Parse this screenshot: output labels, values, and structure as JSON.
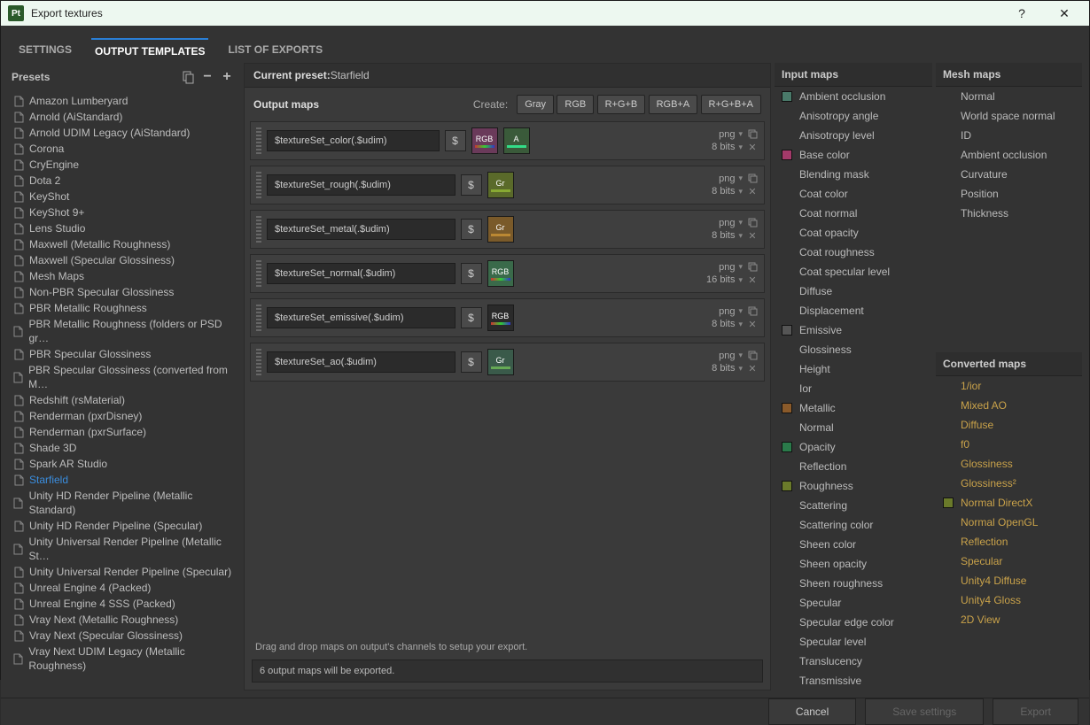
{
  "window": {
    "title": "Export textures",
    "app_badge": "Pt"
  },
  "tabs": {
    "settings": "SETTINGS",
    "output_templates": "OUTPUT TEMPLATES",
    "list_of_exports": "LIST OF EXPORTS"
  },
  "presets": {
    "header": "Presets",
    "items": [
      "Amazon Lumberyard",
      "Arnold (AiStandard)",
      "Arnold UDIM Legacy (AiStandard)",
      "Corona",
      "CryEngine",
      "Dota 2",
      "KeyShot",
      "KeyShot 9+",
      "Lens Studio",
      "Maxwell (Metallic Roughness)",
      "Maxwell (Specular Glossiness)",
      "Mesh Maps",
      "Non-PBR Specular Glossiness",
      "PBR Metallic Roughness",
      "PBR Metallic Roughness (folders or PSD gr…",
      "PBR Specular Glossiness",
      "PBR Specular Glossiness (converted from M…",
      "Redshift (rsMaterial)",
      "Renderman (pxrDisney)",
      "Renderman (pxrSurface)",
      "Shade 3D",
      "Spark AR Studio",
      "Starfield",
      "Unity HD Render Pipeline (Metallic Standard)",
      "Unity HD Render Pipeline (Specular)",
      "Unity Universal Render Pipeline (Metallic St…",
      "Unity Universal Render Pipeline (Specular)",
      "Unreal Engine 4 (Packed)",
      "Unreal Engine 4 SSS (Packed)",
      "Vray Next (Metallic Roughness)",
      "Vray Next (Specular Glossiness)",
      "Vray Next UDIM Legacy (Metallic Roughness)"
    ],
    "selected_index": 22
  },
  "current_preset": {
    "label": "Current preset:",
    "value": "Starfield"
  },
  "output": {
    "header": "Output maps",
    "create_label": "Create:",
    "buttons": [
      "Gray",
      "RGB",
      "R+G+B",
      "RGB+A",
      "R+G+B+A"
    ],
    "maps": [
      {
        "name": "$textureSet_color(.$udim)",
        "chips": [
          {
            "t": "RGB",
            "c": "rgb"
          },
          {
            "t": "A",
            "c": "a"
          }
        ],
        "fmt": "png",
        "bits": "8 bits"
      },
      {
        "name": "$textureSet_rough(.$udim)",
        "chips": [
          {
            "t": "Gr",
            "c": "gr"
          }
        ],
        "fmt": "png",
        "bits": "8 bits"
      },
      {
        "name": "$textureSet_metal(.$udim)",
        "chips": [
          {
            "t": "Gr",
            "c": "gr2"
          }
        ],
        "fmt": "png",
        "bits": "8 bits"
      },
      {
        "name": "$textureSet_normal(.$udim)",
        "chips": [
          {
            "t": "RGB",
            "c": "rgbn"
          }
        ],
        "fmt": "png",
        "bits": "16 bits"
      },
      {
        "name": "$textureSet_emissive(.$udim)",
        "chips": [
          {
            "t": "RGB",
            "c": "rgbe"
          }
        ],
        "fmt": "png",
        "bits": "8 bits"
      },
      {
        "name": "$textureSet_ao(.$udim)",
        "chips": [
          {
            "t": "Gr",
            "c": "grao"
          }
        ],
        "fmt": "png",
        "bits": "8 bits"
      }
    ],
    "drag_hint": "Drag and drop maps on output's channels to setup your export.",
    "status": "6 output maps will be exported."
  },
  "input_maps": {
    "header": "Input maps",
    "items": [
      {
        "label": "Ambient occlusion",
        "swatch": "#4a7a6a"
      },
      {
        "label": "Anisotropy angle"
      },
      {
        "label": "Anisotropy level"
      },
      {
        "label": "Base color",
        "swatch": "#a33a6a"
      },
      {
        "label": "Blending mask"
      },
      {
        "label": "Coat color"
      },
      {
        "label": "Coat normal"
      },
      {
        "label": "Coat opacity"
      },
      {
        "label": "Coat roughness"
      },
      {
        "label": "Coat specular level"
      },
      {
        "label": "Diffuse"
      },
      {
        "label": "Displacement"
      },
      {
        "label": "Emissive",
        "swatch": "#555"
      },
      {
        "label": "Glossiness"
      },
      {
        "label": "Height"
      },
      {
        "label": "Ior"
      },
      {
        "label": "Metallic",
        "swatch": "#8a5a2a"
      },
      {
        "label": "Normal"
      },
      {
        "label": "Opacity",
        "swatch": "#2a7a4a"
      },
      {
        "label": "Reflection"
      },
      {
        "label": "Roughness",
        "swatch": "#6a7a2a"
      },
      {
        "label": "Scattering"
      },
      {
        "label": "Scattering color"
      },
      {
        "label": "Sheen color"
      },
      {
        "label": "Sheen opacity"
      },
      {
        "label": "Sheen roughness"
      },
      {
        "label": "Specular"
      },
      {
        "label": "Specular edge color"
      },
      {
        "label": "Specular level"
      },
      {
        "label": "Translucency"
      },
      {
        "label": "Transmissive"
      }
    ]
  },
  "mesh_maps": {
    "header": "Mesh maps",
    "items": [
      "Normal",
      "World space normal",
      "ID",
      "Ambient occlusion",
      "Curvature",
      "Position",
      "Thickness"
    ]
  },
  "converted_maps": {
    "header": "Converted maps",
    "items": [
      {
        "label": "1/ior"
      },
      {
        "label": "Mixed AO"
      },
      {
        "label": "Diffuse"
      },
      {
        "label": "f0"
      },
      {
        "label": "Glossiness"
      },
      {
        "label": "Glossiness²"
      },
      {
        "label": "Normal DirectX",
        "swatch": "#6a7a2a"
      },
      {
        "label": "Normal OpenGL"
      },
      {
        "label": "Reflection"
      },
      {
        "label": "Specular"
      },
      {
        "label": "Unity4 Diffuse"
      },
      {
        "label": "Unity4 Gloss"
      },
      {
        "label": "2D View"
      }
    ]
  },
  "footer": {
    "cancel": "Cancel",
    "save": "Save settings",
    "export": "Export"
  }
}
